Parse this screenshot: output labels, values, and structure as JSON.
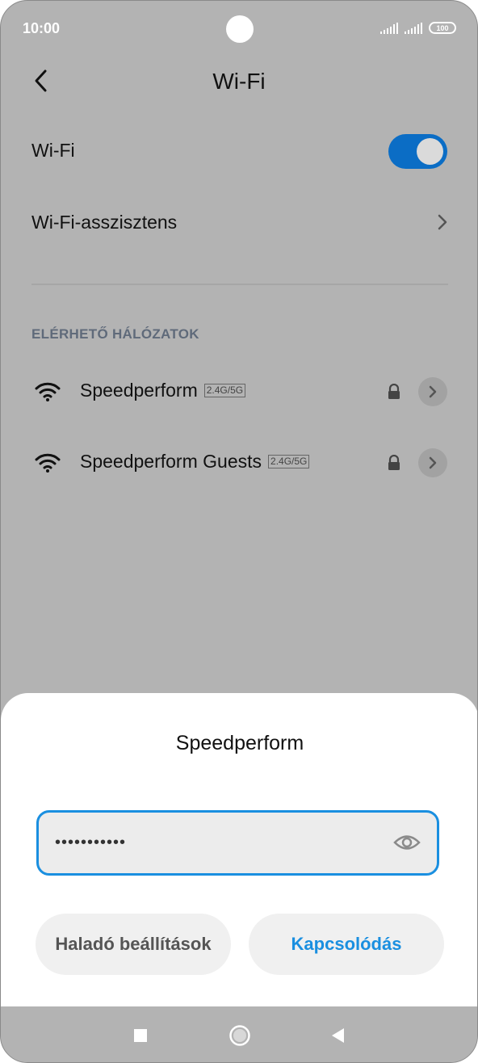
{
  "status_bar": {
    "time": "10:00",
    "battery": "100"
  },
  "header": {
    "title": "Wi-Fi",
    "back_icon": "chevron-left-icon"
  },
  "settings": {
    "wifi_label": "Wi-Fi",
    "wifi_enabled": true,
    "assistant_label": "Wi-Fi-asszisztens",
    "section_header": "ELÉRHETŐ HÁLÓZATOK"
  },
  "networks": [
    {
      "name": "Speedperform",
      "band": "2.4G/5G",
      "secured": true
    },
    {
      "name": "Speedperform Guests",
      "band": "2.4G/5G",
      "secured": true
    }
  ],
  "dialog": {
    "title": "Speedperform",
    "password_value": "•••••••••••",
    "advanced_label": "Haladó beállítások",
    "connect_label": "Kapcsolódás"
  },
  "colors": {
    "accent": "#1a8fe0",
    "toggle_on": "#0b6dc5",
    "scrim": "#b3b3b3"
  }
}
